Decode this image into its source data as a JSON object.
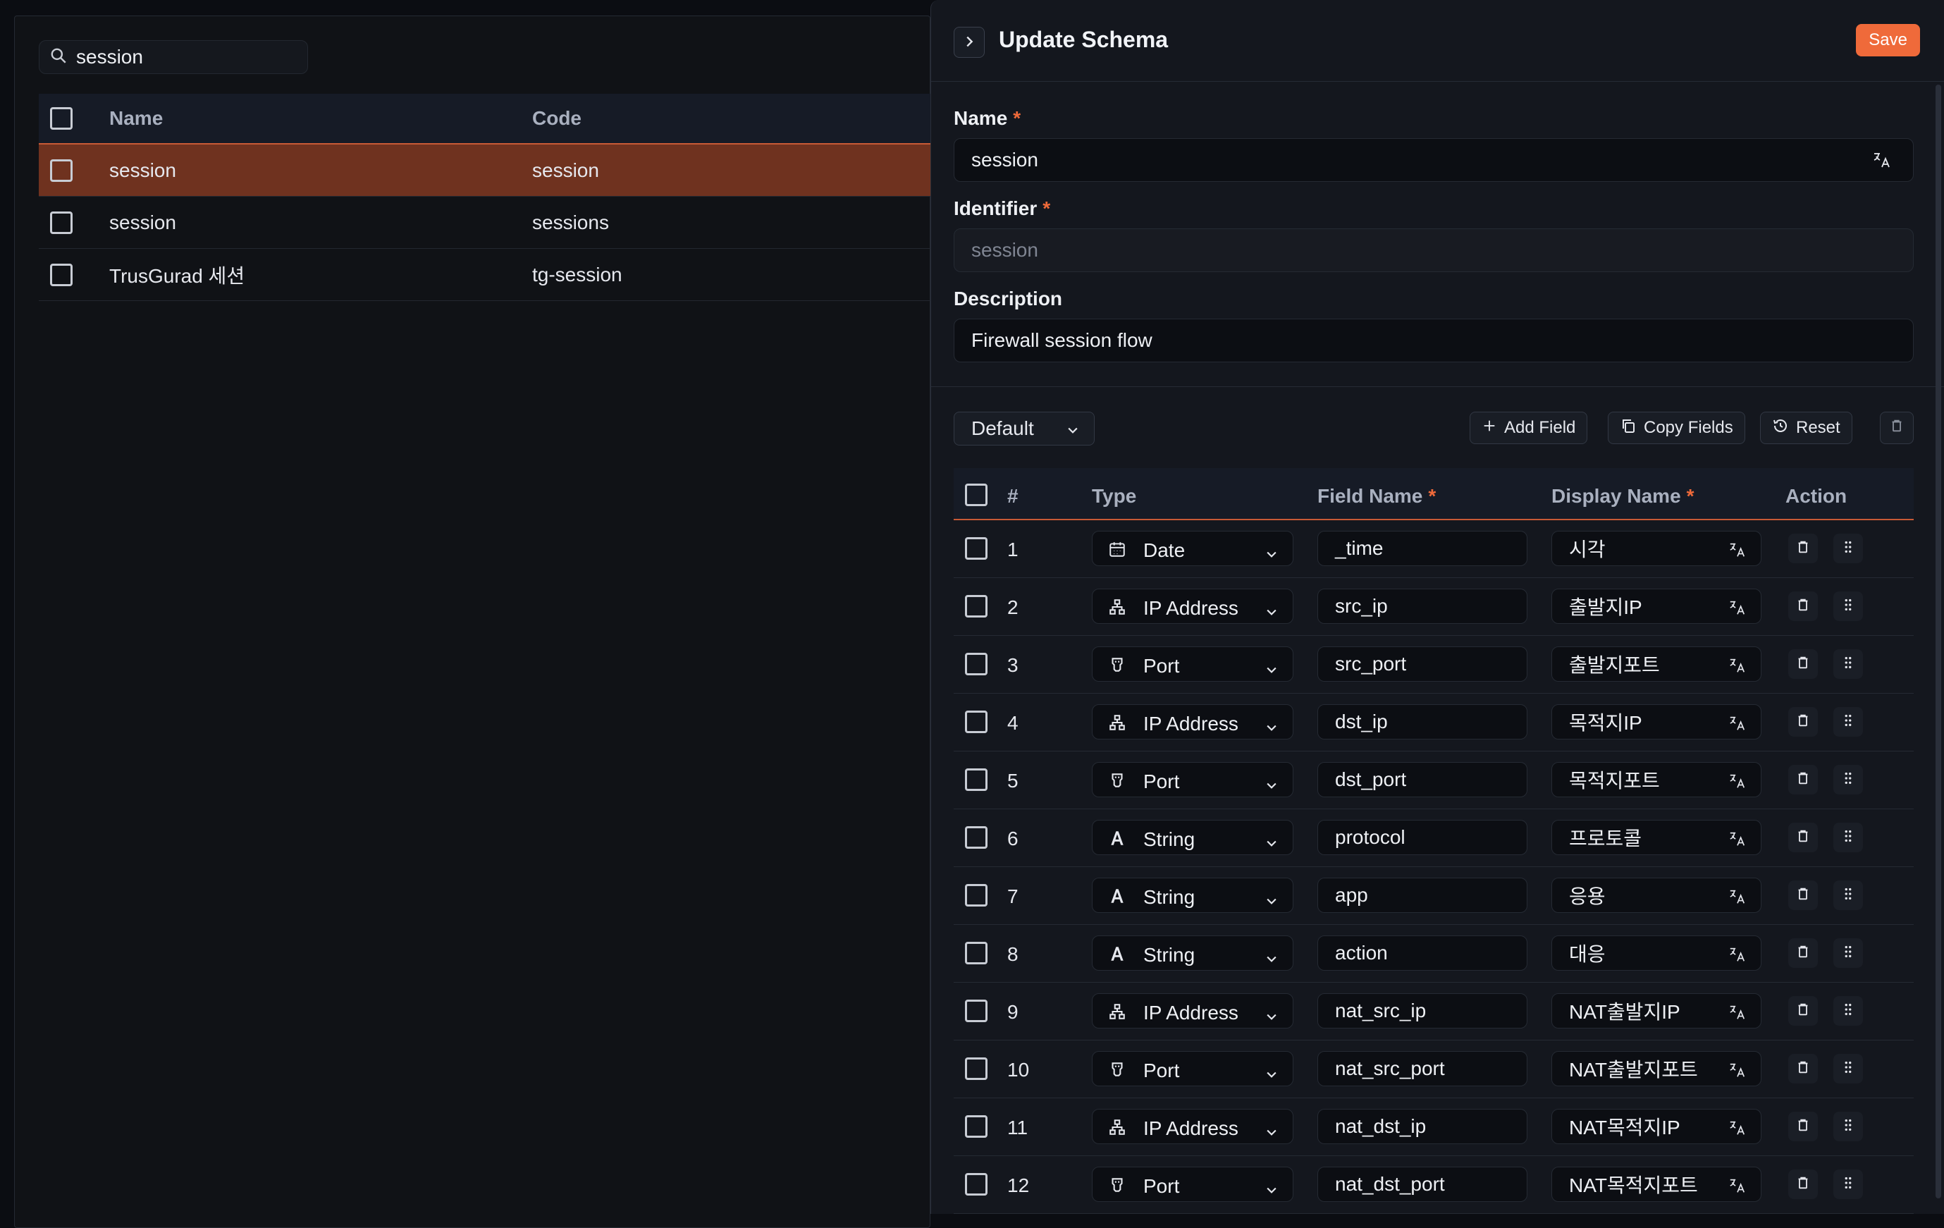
{
  "search": {
    "value": "session"
  },
  "list": {
    "columns": {
      "name": "Name",
      "code": "Code"
    },
    "rows": [
      {
        "name": "session",
        "code": "session",
        "selected": true
      },
      {
        "name": "session",
        "code": "sessions",
        "selected": false
      },
      {
        "name": "TrusGurad 세션",
        "code": "tg-session",
        "selected": false
      }
    ]
  },
  "panel": {
    "title": "Update Schema",
    "save_label": "Save",
    "name_label": "Name",
    "name_value": "session",
    "identifier_label": "Identifier",
    "identifier_value": "session",
    "description_label": "Description",
    "description_value": "Firewall  session flow",
    "required_mark": "*",
    "group_select": "Default",
    "add_field_label": "Add Field",
    "copy_fields_label": "Copy Fields",
    "reset_label": "Reset"
  },
  "fields": {
    "columns": {
      "num": "#",
      "type": "Type",
      "field_name": "Field Name",
      "display_name": "Display Name",
      "action": "Action"
    },
    "rows": [
      {
        "num": "1",
        "type": "Date",
        "icon": "calendar-icon",
        "field": "_time",
        "display": "시각"
      },
      {
        "num": "2",
        "type": "IP Address",
        "icon": "network-icon",
        "field": "src_ip",
        "display": "출발지IP"
      },
      {
        "num": "3",
        "type": "Port",
        "icon": "port-icon",
        "field": "src_port",
        "display": "출발지포트"
      },
      {
        "num": "4",
        "type": "IP Address",
        "icon": "network-icon",
        "field": "dst_ip",
        "display": "목적지IP"
      },
      {
        "num": "5",
        "type": "Port",
        "icon": "port-icon",
        "field": "dst_port",
        "display": "목적지포트"
      },
      {
        "num": "6",
        "type": "String",
        "icon": "text-icon",
        "field": "protocol",
        "display": "프로토콜"
      },
      {
        "num": "7",
        "type": "String",
        "icon": "text-icon",
        "field": "app",
        "display": "응용"
      },
      {
        "num": "8",
        "type": "String",
        "icon": "text-icon",
        "field": "action",
        "display": "대응"
      },
      {
        "num": "9",
        "type": "IP Address",
        "icon": "network-icon",
        "field": "nat_src_ip",
        "display": "NAT출발지IP"
      },
      {
        "num": "10",
        "type": "Port",
        "icon": "port-icon",
        "field": "nat_src_port",
        "display": "NAT출발지포트"
      },
      {
        "num": "11",
        "type": "IP Address",
        "icon": "network-icon",
        "field": "nat_dst_ip",
        "display": "NAT목적지IP"
      },
      {
        "num": "12",
        "type": "Port",
        "icon": "port-icon",
        "field": "nat_dst_port",
        "display": "NAT목적지포트"
      }
    ]
  },
  "colors": {
    "accent": "#ef6a3a",
    "selected_row": "#6f321f",
    "background": "#0b0d12"
  }
}
